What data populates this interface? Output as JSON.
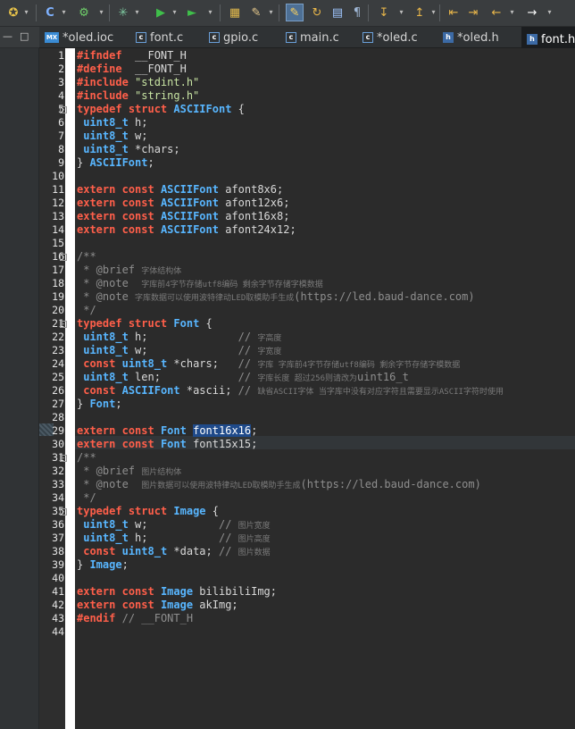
{
  "toolbar": {
    "icons": [
      "new-wizard-icon",
      "new-c-file-icon",
      "build-icon",
      "debug-icon",
      "run-icon",
      "run-config-icon",
      "open-folder-icon",
      "brush-icon",
      "toggle-mark-icon",
      "last-edit-icon",
      "block-select-icon",
      "pilcrow-icon",
      "download-icon",
      "upload-icon",
      "back-nav-icon",
      "forward-nav-icon",
      "arrow-left-icon",
      "arrow-right-icon"
    ]
  },
  "tabs": [
    {
      "label": "*oled.ioc",
      "icon": "MX"
    },
    {
      "label": "font.c",
      "icon": "c"
    },
    {
      "label": "gpio.c",
      "icon": "c"
    },
    {
      "label": "main.c",
      "icon": "c"
    },
    {
      "label": "*oled.c",
      "icon": "c"
    },
    {
      "label": "*oled.h",
      "icon": "h"
    },
    {
      "label": "font.h",
      "icon": "h",
      "active": true
    }
  ],
  "editor": {
    "line_numbers": [
      "1",
      "2",
      "3",
      "4",
      "5",
      "6",
      "7",
      "8",
      "9",
      "10",
      "11",
      "12",
      "13",
      "14",
      "15",
      "16",
      "17",
      "18",
      "19",
      "20",
      "21",
      "22",
      "23",
      "24",
      "25",
      "26",
      "27",
      "28",
      "29",
      "30",
      "31",
      "32",
      "33",
      "34",
      "35",
      "36",
      "37",
      "38",
      "39",
      "40",
      "41",
      "42",
      "43",
      "44"
    ],
    "lines": [
      [
        [
          "pp",
          "#ifndef"
        ],
        [
          "",
          "  __FONT_H"
        ]
      ],
      [
        [
          "pp",
          "#define"
        ],
        [
          "",
          "  __FONT_H"
        ]
      ],
      [
        [
          "pp",
          "#include"
        ],
        [
          "",
          " "
        ],
        [
          "st",
          "\"stdint.h\""
        ]
      ],
      [
        [
          "pp",
          "#include"
        ],
        [
          "",
          " "
        ],
        [
          "st",
          "\"string.h\""
        ]
      ],
      [
        [
          "kw",
          "typedef"
        ],
        [
          "",
          " "
        ],
        [
          "kw",
          "struct"
        ],
        [
          "",
          " "
        ],
        [
          "ty",
          "ASCIIFont"
        ],
        [
          "",
          " {"
        ]
      ],
      [
        [
          "",
          " "
        ],
        [
          "ty",
          "uint8_t"
        ],
        [
          "",
          " h;"
        ]
      ],
      [
        [
          "",
          " "
        ],
        [
          "ty",
          "uint8_t"
        ],
        [
          "",
          " w;"
        ]
      ],
      [
        [
          "",
          " "
        ],
        [
          "ty",
          "uint8_t"
        ],
        [
          "",
          " *chars;"
        ]
      ],
      [
        [
          "",
          "} "
        ],
        [
          "ty",
          "ASCIIFont"
        ],
        [
          "",
          ";"
        ]
      ],
      [],
      [
        [
          "kw",
          "extern"
        ],
        [
          "",
          " "
        ],
        [
          "kw",
          "const"
        ],
        [
          "",
          " "
        ],
        [
          "ty",
          "ASCIIFont"
        ],
        [
          "",
          " afont8x6;"
        ]
      ],
      [
        [
          "kw",
          "extern"
        ],
        [
          "",
          " "
        ],
        [
          "kw",
          "const"
        ],
        [
          "",
          " "
        ],
        [
          "ty",
          "ASCIIFont"
        ],
        [
          "",
          " afont12x6;"
        ]
      ],
      [
        [
          "kw",
          "extern"
        ],
        [
          "",
          " "
        ],
        [
          "kw",
          "const"
        ],
        [
          "",
          " "
        ],
        [
          "ty",
          "ASCIIFont"
        ],
        [
          "",
          " afont16x8;"
        ]
      ],
      [
        [
          "kw",
          "extern"
        ],
        [
          "",
          " "
        ],
        [
          "kw",
          "const"
        ],
        [
          "",
          " "
        ],
        [
          "ty",
          "ASCIIFont"
        ],
        [
          "",
          " afont24x12;"
        ]
      ],
      [],
      [
        [
          "cm",
          "/**"
        ]
      ],
      [
        [
          "cm",
          " * @brief "
        ],
        [
          "cmz",
          "字体结构体"
        ]
      ],
      [
        [
          "cm",
          " * @note  "
        ],
        [
          "cmz",
          "字库前4字节存储utf8编码 剩余字节存储字模数据"
        ]
      ],
      [
        [
          "cm",
          " * @note "
        ],
        [
          "cmz",
          "字库数据可以使用波特律动LED取模助手生成"
        ],
        [
          "cm",
          "(https://led.baud-dance.com)"
        ]
      ],
      [
        [
          "cm",
          " */"
        ]
      ],
      [
        [
          "kw",
          "typedef"
        ],
        [
          "",
          " "
        ],
        [
          "kw",
          "struct"
        ],
        [
          "",
          " "
        ],
        [
          "ty",
          "Font"
        ],
        [
          "",
          " {"
        ]
      ],
      [
        [
          "",
          " "
        ],
        [
          "ty",
          "uint8_t"
        ],
        [
          "",
          " h;              "
        ],
        [
          "cm",
          "// "
        ],
        [
          "cmz",
          "字高度"
        ]
      ],
      [
        [
          "",
          " "
        ],
        [
          "ty",
          "uint8_t"
        ],
        [
          "",
          " w;              "
        ],
        [
          "cm",
          "// "
        ],
        [
          "cmz",
          "字宽度"
        ]
      ],
      [
        [
          "",
          " "
        ],
        [
          "kw",
          "const"
        ],
        [
          "",
          " "
        ],
        [
          "ty",
          "uint8_t"
        ],
        [
          "",
          " *chars;   "
        ],
        [
          "cm",
          "// "
        ],
        [
          "cmz",
          "字库 字库前4字节存储utf8编码 剩余字节存储字模数据"
        ]
      ],
      [
        [
          "",
          " "
        ],
        [
          "ty",
          "uint8_t"
        ],
        [
          "",
          " len;            "
        ],
        [
          "cm",
          "// "
        ],
        [
          "cmz",
          "字库长度 超过256则请改为"
        ],
        [
          "cm",
          "uint16_t"
        ]
      ],
      [
        [
          "",
          " "
        ],
        [
          "kw",
          "const"
        ],
        [
          "",
          " "
        ],
        [
          "ty",
          "ASCIIFont"
        ],
        [
          "",
          " *ascii; "
        ],
        [
          "cm",
          "// "
        ],
        [
          "cmz",
          "缺省ASCII字体 当字库中没有对应字符且需要显示ASCII字符时使用"
        ]
      ],
      [
        [
          "",
          "} "
        ],
        [
          "ty",
          "Font"
        ],
        [
          "",
          ";"
        ]
      ],
      [],
      [
        [
          "kw",
          "extern"
        ],
        [
          "",
          " "
        ],
        [
          "kw",
          "const"
        ],
        [
          "",
          " "
        ],
        [
          "ty",
          "Font"
        ],
        [
          "",
          " "
        ],
        [
          "sel",
          "font16x16"
        ],
        [
          "",
          ";"
        ]
      ],
      [
        [
          "kw",
          "extern"
        ],
        [
          "",
          " "
        ],
        [
          "kw",
          "const"
        ],
        [
          "",
          " "
        ],
        [
          "ty",
          "Font"
        ],
        [
          "",
          " font15x15;"
        ]
      ],
      [
        [
          "cm",
          "/**"
        ]
      ],
      [
        [
          "cm",
          " * @brief "
        ],
        [
          "cmz",
          "图片结构体"
        ]
      ],
      [
        [
          "cm",
          " * @note  "
        ],
        [
          "cmz",
          "图片数据可以使用波特律动LED取模助手生成"
        ],
        [
          "cm",
          "(https://led.baud-dance.com)"
        ]
      ],
      [
        [
          "cm",
          " */"
        ]
      ],
      [
        [
          "kw",
          "typedef"
        ],
        [
          "",
          " "
        ],
        [
          "kw",
          "struct"
        ],
        [
          "",
          " "
        ],
        [
          "ty",
          "Image"
        ],
        [
          "",
          " {"
        ]
      ],
      [
        [
          "",
          " "
        ],
        [
          "ty",
          "uint8_t"
        ],
        [
          "",
          " w;           "
        ],
        [
          "cm",
          "// "
        ],
        [
          "cmz",
          "图片宽度"
        ]
      ],
      [
        [
          "",
          " "
        ],
        [
          "ty",
          "uint8_t"
        ],
        [
          "",
          " h;           "
        ],
        [
          "cm",
          "// "
        ],
        [
          "cmz",
          "图片高度"
        ]
      ],
      [
        [
          "",
          " "
        ],
        [
          "kw",
          "const"
        ],
        [
          "",
          " "
        ],
        [
          "ty",
          "uint8_t"
        ],
        [
          "",
          " *data; "
        ],
        [
          "cm",
          "// "
        ],
        [
          "cmz",
          "图片数据"
        ]
      ],
      [
        [
          "",
          "} "
        ],
        [
          "ty",
          "Image"
        ],
        [
          "",
          ";"
        ]
      ],
      [],
      [
        [
          "kw",
          "extern"
        ],
        [
          "",
          " "
        ],
        [
          "kw",
          "const"
        ],
        [
          "",
          " "
        ],
        [
          "ty",
          "Image"
        ],
        [
          "",
          " bilibiliImg;"
        ]
      ],
      [
        [
          "kw",
          "extern"
        ],
        [
          "",
          " "
        ],
        [
          "kw",
          "const"
        ],
        [
          "",
          " "
        ],
        [
          "ty",
          "Image"
        ],
        [
          "",
          " akImg;"
        ]
      ],
      [
        [
          "pp",
          "#endif"
        ],
        [
          "",
          " "
        ],
        [
          "cm",
          "// __FONT_H"
        ]
      ],
      []
    ],
    "folds": [
      5,
      16,
      21,
      31,
      35
    ]
  }
}
